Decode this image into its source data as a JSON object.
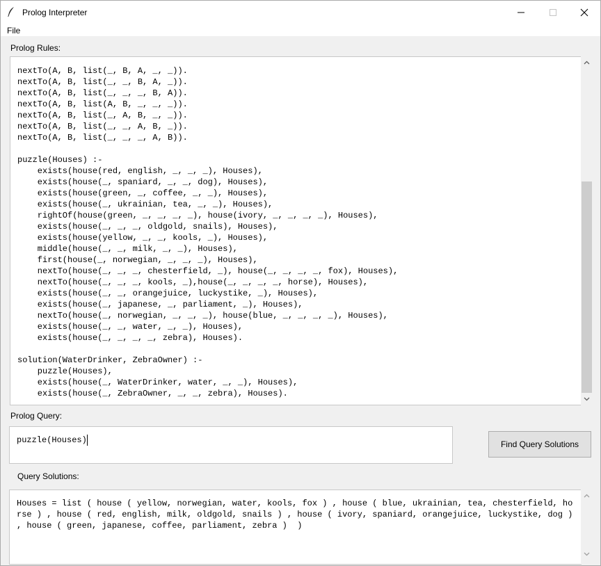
{
  "window": {
    "title": "Prolog Interpreter"
  },
  "menu": {
    "file_label": "File"
  },
  "rules": {
    "label": "Prolog Rules:",
    "text": "nextTo(A, B, list(_, B, A, _, _)).\nnextTo(A, B, list(_, _, B, A, _)).\nnextTo(A, B, list(_, _, _, B, A)).\nnextTo(A, B, list(A, B, _, _, _)).\nnextTo(A, B, list(_, A, B, _, _)).\nnextTo(A, B, list(_, _, A, B, _)).\nnextTo(A, B, list(_, _, _, A, B)).\n\npuzzle(Houses) :-\n    exists(house(red, english, _, _, _), Houses),\n    exists(house(_, spaniard, _, _, dog), Houses),\n    exists(house(green, _, coffee, _, _), Houses),\n    exists(house(_, ukrainian, tea, _, _), Houses),\n    rightOf(house(green, _, _, _, _), house(ivory, _, _, _, _), Houses),\n    exists(house(_, _, _, oldgold, snails), Houses),\n    exists(house(yellow, _, _, kools, _), Houses),\n    middle(house(_, _, milk, _, _), Houses),\n    first(house(_, norwegian, _, _, _), Houses),\n    nextTo(house(_, _, _, chesterfield, _), house(_, _, _, _, fox), Houses),\n    nextTo(house(_, _, _, kools, _),house(_, _, _, _, horse), Houses),\n    exists(house(_, _, orangejuice, luckystike, _), Houses),\n    exists(house(_, japanese, _, parliament, _), Houses),\n    nextTo(house(_, norwegian, _, _, _), house(blue, _, _, _, _), Houses),\n    exists(house(_, _, water, _, _), Houses),\n    exists(house(_, _, _, _, zebra), Houses).\n\nsolution(WaterDrinker, ZebraOwner) :-\n    puzzle(Houses),\n    exists(house(_, WaterDrinker, water, _, _), Houses),\n    exists(house(_, ZebraOwner, _, _, zebra), Houses)."
  },
  "query": {
    "label": "Prolog Query:",
    "value": "puzzle(Houses)"
  },
  "find_button_label": "Find Query Solutions",
  "solutions": {
    "label": "Query Solutions:",
    "text": "Houses = list ( house ( yellow, norwegian, water, kools, fox ) , house ( blue, ukrainian, tea, chesterfield, horse ) , house ( red, english, milk, oldgold, snails ) , house ( ivory, spaniard, orangejuice, luckystike, dog ) , house ( green, japanese, coffee, parliament, zebra )  )"
  },
  "icons": {
    "app": "feather-icon",
    "minimize": "minimize-icon",
    "maximize": "maximize-icon",
    "close": "close-icon",
    "scroll_up": "chevron-up-icon",
    "scroll_down": "chevron-down-icon"
  }
}
